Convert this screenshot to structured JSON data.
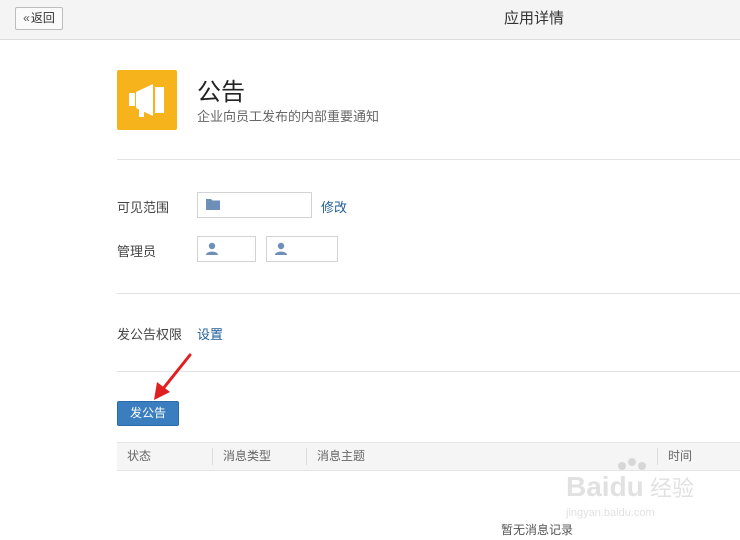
{
  "header": {
    "back_label": "返回",
    "title": "应用详情"
  },
  "app": {
    "name": "公告",
    "description": "企业向员工发布的内部重要通知",
    "icon": "megaphone-icon",
    "icon_color": "#f7b31b"
  },
  "settings": {
    "visible_range_label": "可见范围",
    "modify_link": "修改",
    "admin_label": "管理员",
    "permission_label": "发公告权限",
    "setup_link": "设置"
  },
  "actions": {
    "publish_button": "发公告",
    "accent_color": "#3a7ec0"
  },
  "table": {
    "columns": [
      "状态",
      "消息类型",
      "消息主题",
      "时间"
    ],
    "empty_text": "暂无消息记录"
  },
  "watermark": {
    "brand": "Baidu经验",
    "url": "jingyan.baidu.com"
  }
}
